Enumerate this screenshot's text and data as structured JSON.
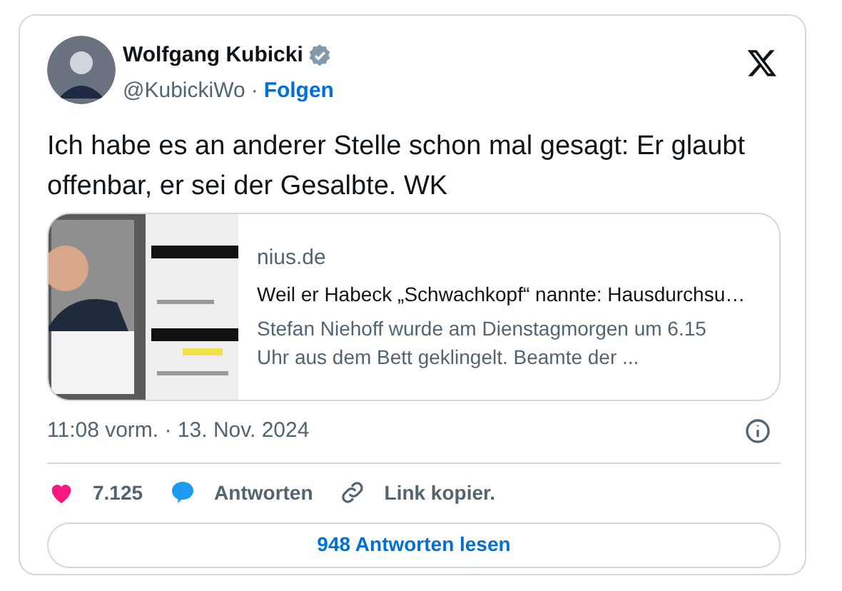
{
  "author": {
    "name": "Wolfgang Kubicki",
    "verified": true,
    "handle": "@KubickiWo",
    "separator": "·",
    "follow": "Folgen"
  },
  "text": "Ich habe es an anderer Stelle schon mal gesagt: Er glaubt offenbar, er sei der Gesalbte. WK",
  "link_card": {
    "source": "nius.de",
    "title": "Weil er Habeck „Schwachkopf“ nannte: Hausdurchsu…",
    "description": "Stefan Niehoff wurde am Dienstagmorgen um 6.15 Uhr aus dem Bett geklingelt. Beamte der ..."
  },
  "timestamp": "11:08 vorm. · 13. Nov. 2024",
  "actions": [
    {
      "kind": "like",
      "label": "7.125"
    },
    {
      "kind": "reply",
      "label": "Antworten"
    },
    {
      "kind": "copy",
      "label": "Link kopier."
    }
  ],
  "replies_button": "948 Antworten lesen"
}
